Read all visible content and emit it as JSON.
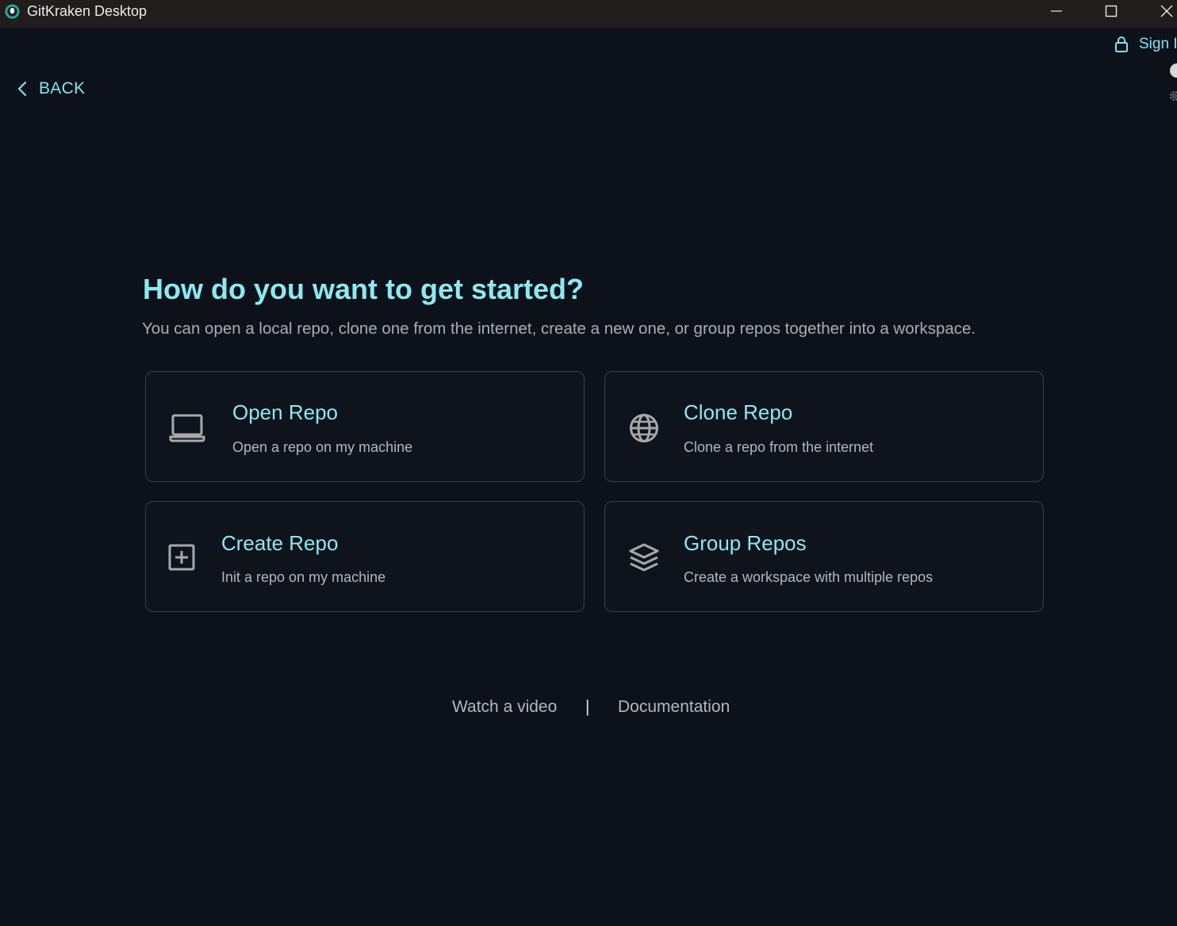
{
  "window": {
    "title": "GitKraken Desktop",
    "controls": [
      "minimize",
      "maximize",
      "close"
    ]
  },
  "header": {
    "sign_in_label": "Sign I",
    "back_label": "BACK"
  },
  "main": {
    "heading": "How do you want to get started?",
    "subheading": "You can open a local repo, clone one from the internet, create a new one, or group repos together into a workspace.",
    "cards": [
      {
        "icon": "laptop-icon",
        "title": "Open Repo",
        "description": "Open a repo on my machine"
      },
      {
        "icon": "globe-icon",
        "title": "Clone Repo",
        "description": "Clone a repo from the internet"
      },
      {
        "icon": "plus-square-icon",
        "title": "Create Repo",
        "description": "Init a repo on my machine"
      },
      {
        "icon": "layers-icon",
        "title": "Group Repos",
        "description": "Create a workspace with multiple repos"
      }
    ]
  },
  "footer": {
    "video_label": "Watch a video",
    "separator": "|",
    "docs_label": "Documentation"
  },
  "colors": {
    "background": "#0d111a",
    "titlebar": "#221d1d",
    "accent": "#8ce9f0",
    "muted_text": "#a9adb4",
    "card_border": "#3b3f47"
  }
}
